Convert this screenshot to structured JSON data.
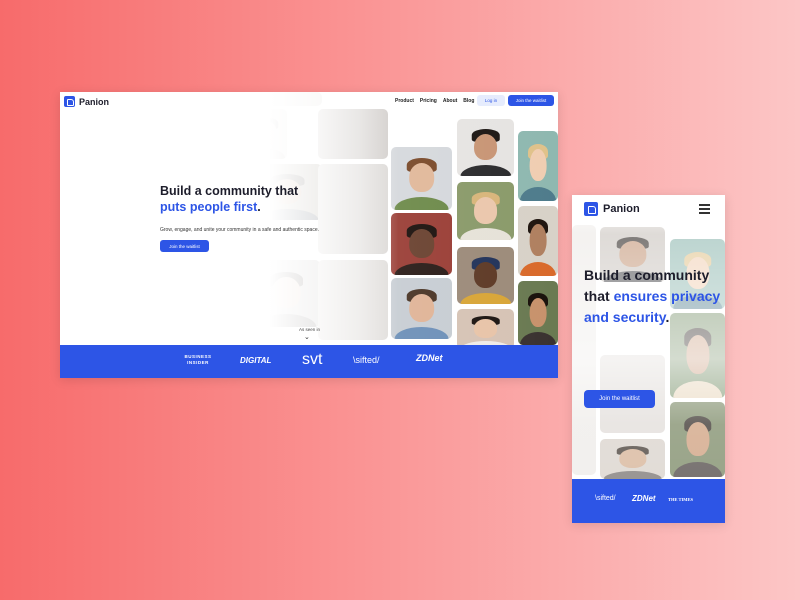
{
  "desktop": {
    "brand": "Panion",
    "nav_links": [
      "Product",
      "Pricing",
      "About",
      "Blog"
    ],
    "login_label": "Log in",
    "join_label": "Join the waitlist",
    "headline_line1": "Build a community that",
    "headline_accent": "puts people first",
    "headline_end": ".",
    "subheadline": "Grow, engage, and unite your community in a safe and authentic space.",
    "cta_label": "Join the waitlist",
    "as_seen_in": "As seen in",
    "press_logos": [
      "BUSINESS INSIDER",
      "DIGITAL",
      "svt",
      "\\sifted/",
      "ZDNet"
    ]
  },
  "mobile": {
    "brand": "Panion",
    "headline_plain": "Build a community that",
    "headline_accent": "ensures privacy and security",
    "headline_end": ".",
    "cta_label": "Join the waitlist",
    "press_logos": [
      "\\sifted/",
      "ZDNet",
      "THE TIMES"
    ]
  },
  "colors": {
    "accent": "#2d55e6",
    "background_left": "#f76b6b",
    "background_right": "#fcc6c6"
  },
  "icons": {
    "logo": "panion-logo-icon",
    "menu": "hamburger-menu-icon",
    "scroll": "chevron-down-icon"
  }
}
